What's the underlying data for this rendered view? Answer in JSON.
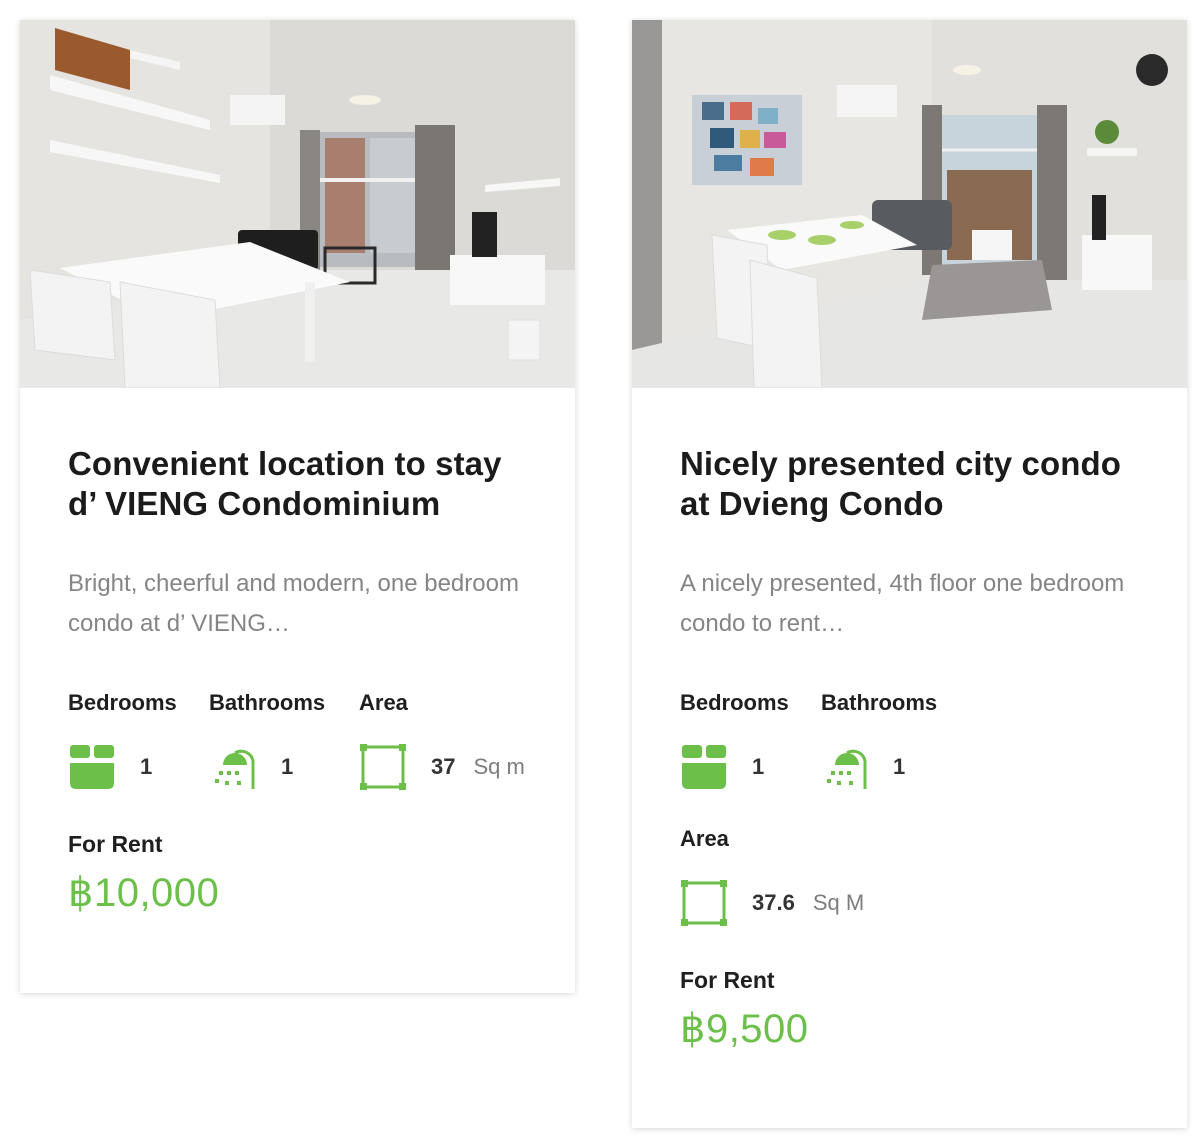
{
  "colors": {
    "accent": "#6cc04a",
    "title": "#1b1b1b",
    "muted": "#858585"
  },
  "listings": [
    {
      "title": "Convenient location to stay d’ VIENG Condominium",
      "description": "Bright, cheerful and modern, one bedroom condo at d’ VIENG…",
      "features": {
        "bedrooms_label": "Bedrooms",
        "bedrooms": "1",
        "bathrooms_label": "Bathrooms",
        "bathrooms": "1",
        "area_label": "Area",
        "area": "37",
        "area_unit": "Sq m"
      },
      "price_label": "For Rent",
      "price": "฿10,000",
      "icons": [
        "bed-icon",
        "shower-icon",
        "area-icon"
      ]
    },
    {
      "title": "Nicely presented city condo at Dvieng Condo",
      "description": "A nicely presented, 4th floor one bedroom condo to rent…",
      "features": {
        "bedrooms_label": "Bedrooms",
        "bedrooms": "1",
        "bathrooms_label": "Bathrooms",
        "bathrooms": "1",
        "area_label": "Area",
        "area": "37.6",
        "area_unit": "Sq M"
      },
      "price_label": "For Rent",
      "price": "฿9,500",
      "icons": [
        "bed-icon",
        "shower-icon",
        "area-icon"
      ]
    }
  ]
}
